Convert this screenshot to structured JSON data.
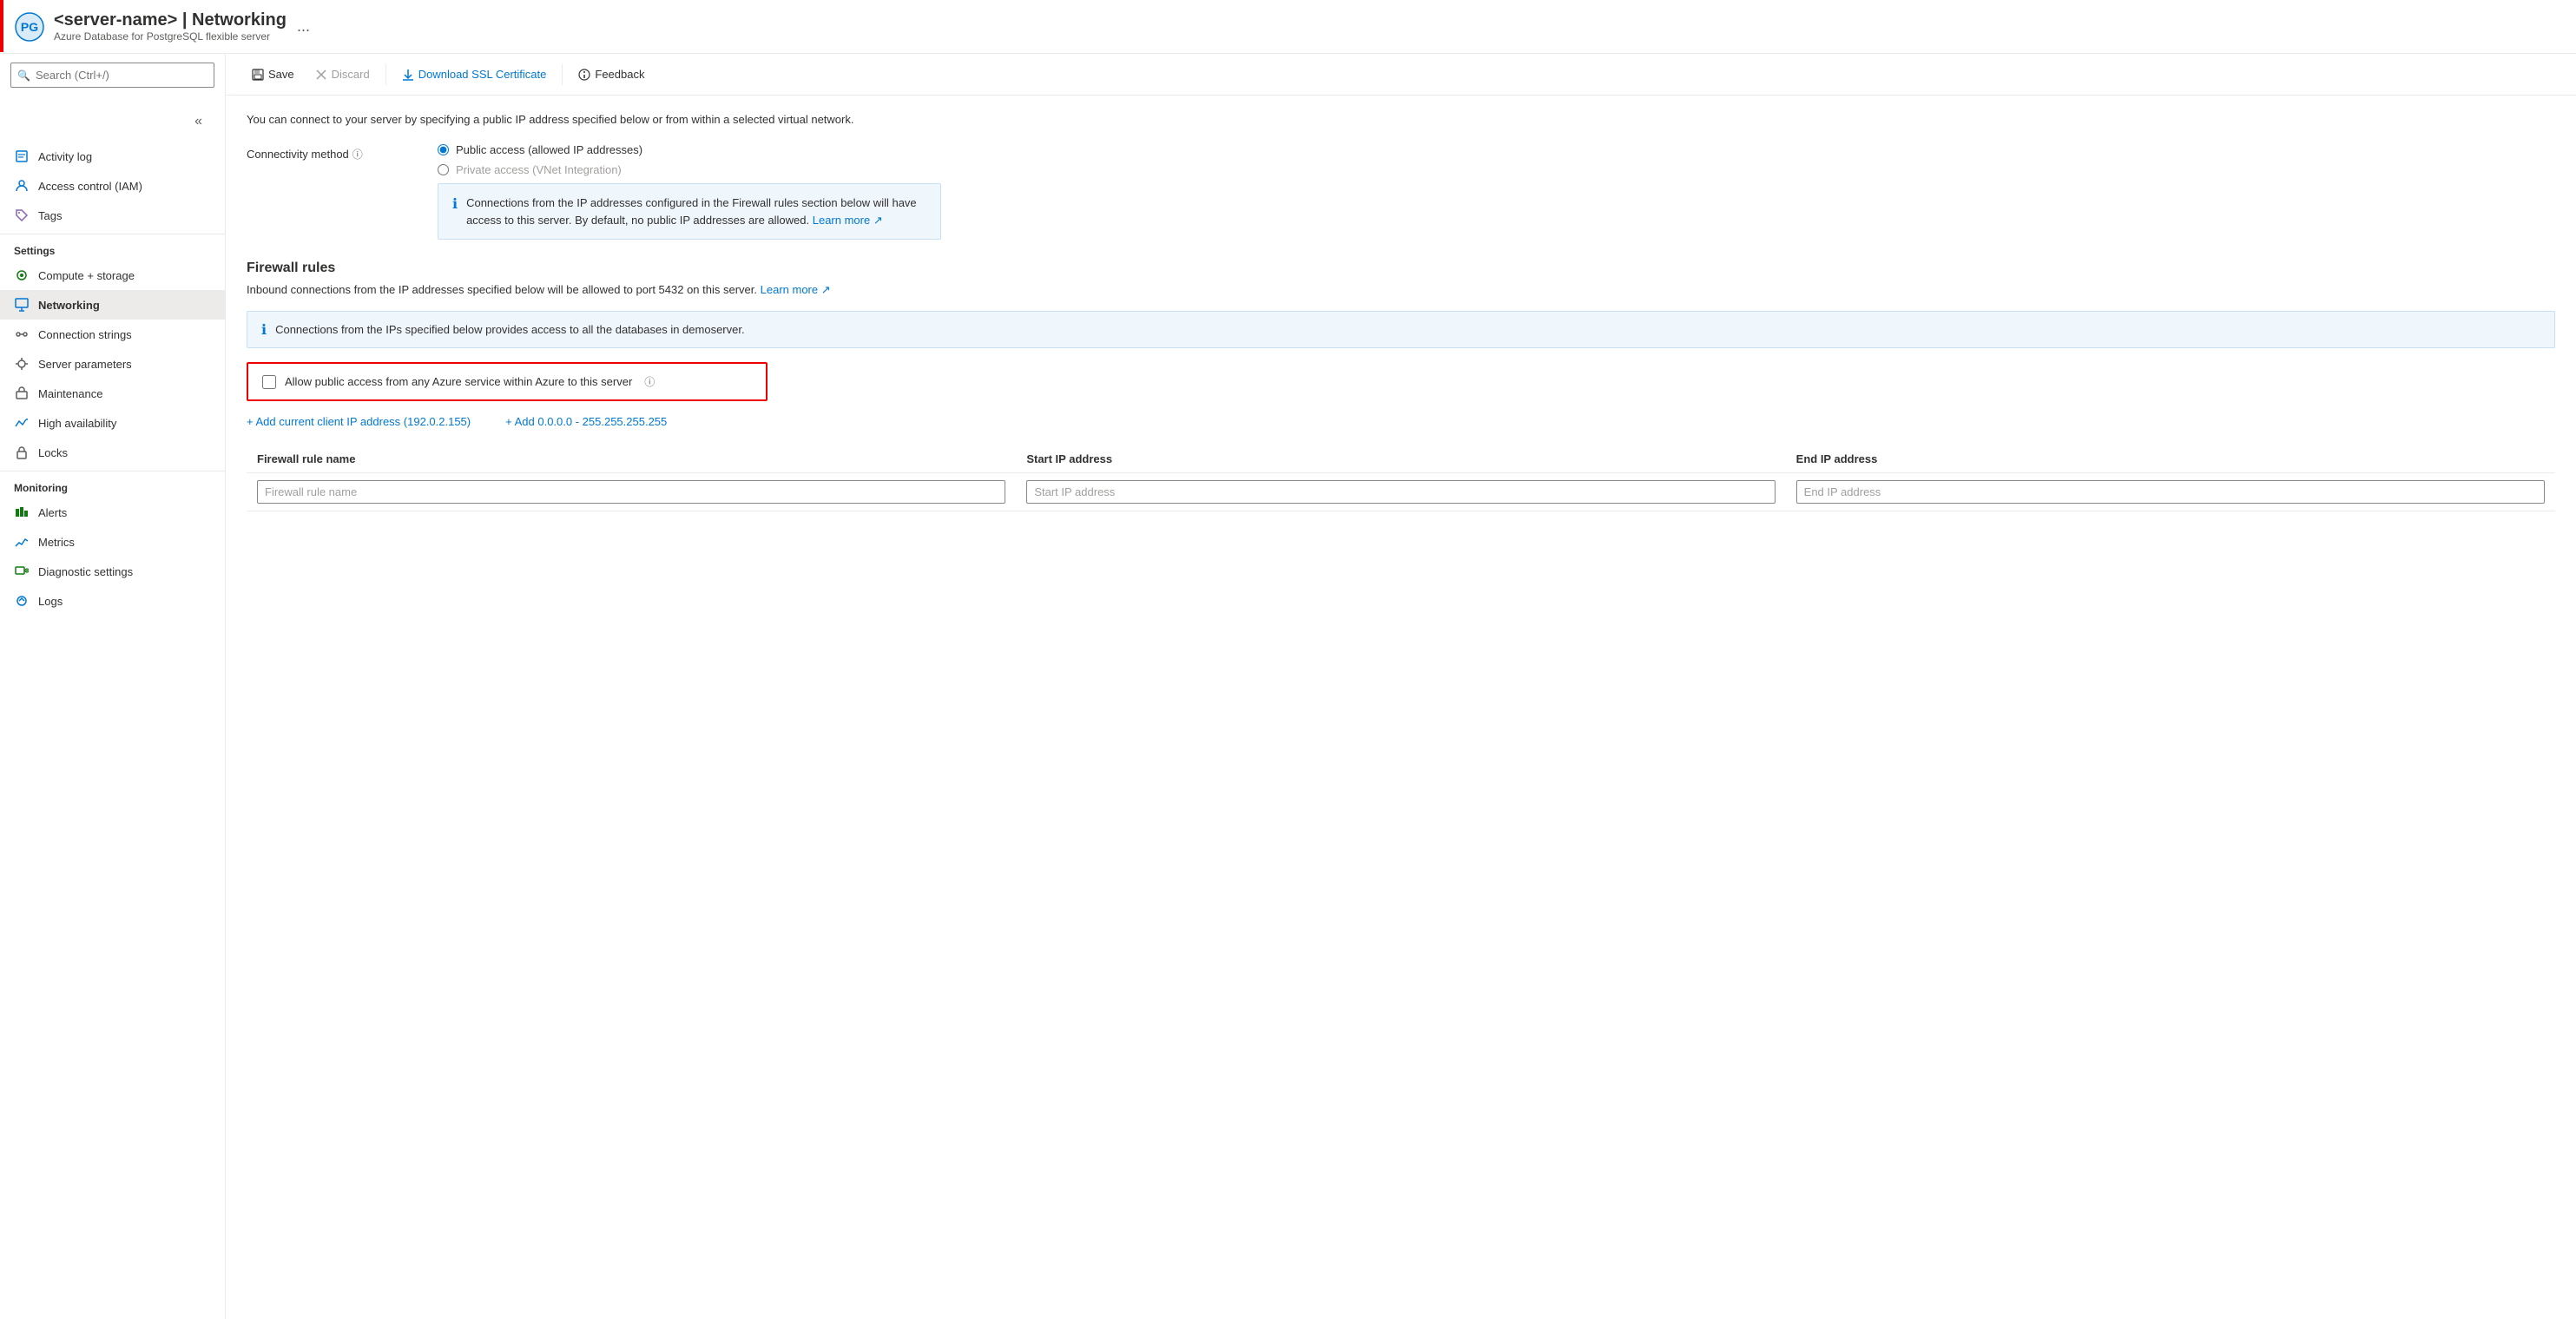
{
  "header": {
    "title": "<server-name> | Networking",
    "server_name": "<server-name>",
    "page_name": "Networking",
    "subtitle": "Azure Database for PostgreSQL flexible server",
    "ellipsis": "..."
  },
  "search": {
    "placeholder": "Search (Ctrl+/)"
  },
  "sidebar": {
    "sections": [
      {
        "title": null,
        "items": [
          {
            "id": "activity-log",
            "label": "Activity log",
            "icon": "activity-log-icon"
          },
          {
            "id": "access-control",
            "label": "Access control (IAM)",
            "icon": "access-control-icon"
          },
          {
            "id": "tags",
            "label": "Tags",
            "icon": "tags-icon"
          }
        ]
      },
      {
        "title": "Settings",
        "items": [
          {
            "id": "compute-storage",
            "label": "Compute + storage",
            "icon": "compute-icon"
          },
          {
            "id": "networking",
            "label": "Networking",
            "icon": "networking-icon",
            "active": true
          },
          {
            "id": "connection-strings",
            "label": "Connection strings",
            "icon": "connection-icon"
          },
          {
            "id": "server-parameters",
            "label": "Server parameters",
            "icon": "server-params-icon"
          },
          {
            "id": "maintenance",
            "label": "Maintenance",
            "icon": "maintenance-icon"
          },
          {
            "id": "high-availability",
            "label": "High availability",
            "icon": "ha-icon"
          },
          {
            "id": "locks",
            "label": "Locks",
            "icon": "locks-icon"
          }
        ]
      },
      {
        "title": "Monitoring",
        "items": [
          {
            "id": "alerts",
            "label": "Alerts",
            "icon": "alerts-icon"
          },
          {
            "id": "metrics",
            "label": "Metrics",
            "icon": "metrics-icon"
          },
          {
            "id": "diagnostic-settings",
            "label": "Diagnostic settings",
            "icon": "diagnostic-icon"
          },
          {
            "id": "logs",
            "label": "Logs",
            "icon": "logs-icon"
          }
        ]
      }
    ]
  },
  "toolbar": {
    "save_label": "Save",
    "discard_label": "Discard",
    "download_ssl_label": "Download SSL Certificate",
    "feedback_label": "Feedback"
  },
  "content": {
    "description": "You can connect to your server by specifying a public IP address specified below or from within a selected virtual network.",
    "connectivity_method_label": "Connectivity method",
    "connectivity_info_icon": "ℹ",
    "radio_public": "Public access (allowed IP addresses)",
    "radio_private": "Private access (VNet Integration)",
    "info_box_text": "Connections from the IP addresses configured in the Firewall rules section below will have access to this server. By default, no public IP addresses are allowed.",
    "info_box_link": "Learn more",
    "firewall_section_title": "Firewall rules",
    "firewall_section_desc": "Inbound connections from the IP addresses specified below will be allowed to port 5432 on this server.",
    "firewall_learn_more": "Learn more",
    "firewall_banner_text": "Connections from the IPs specified below provides access to all the databases in demoserver.",
    "checkbox_label": "Allow public access from any Azure service within Azure to this server",
    "add_client_ip_label": "+ Add current client IP address (192.0.2.155)",
    "add_all_ip_label": "+ Add 0.0.0.0 - 255.255.255.255",
    "table": {
      "columns": [
        "Firewall rule name",
        "Start IP address",
        "End IP address"
      ],
      "placeholders": [
        "Firewall rule name",
        "Start IP address",
        "End IP address"
      ]
    }
  }
}
